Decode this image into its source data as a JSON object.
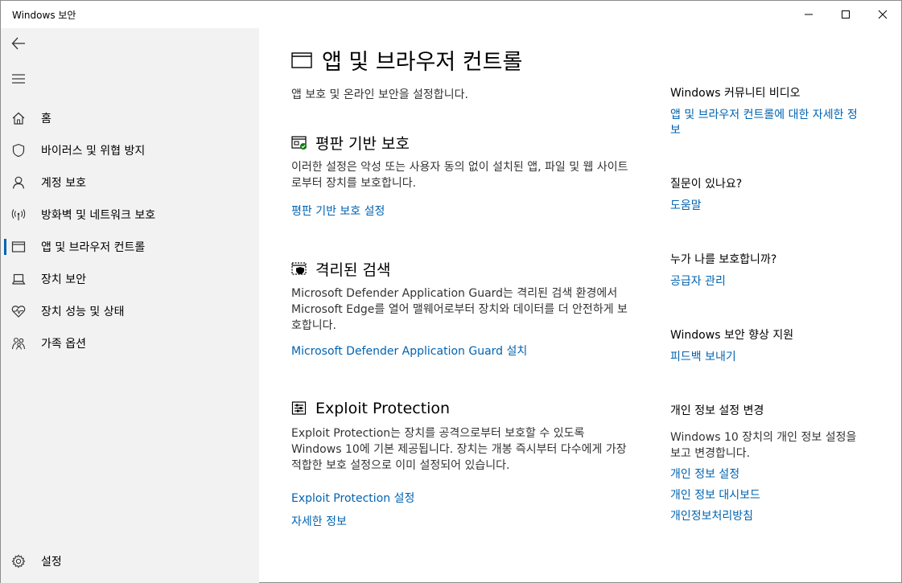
{
  "window": {
    "title": "Windows 보안",
    "controls": [
      "minimize-icon",
      "maximize-icon",
      "close-icon"
    ]
  },
  "sidebar": {
    "back_icon": "back-arrow-icon",
    "menu_icon": "hamburger-icon",
    "items": [
      {
        "label": "홈",
        "icon": "home-icon"
      },
      {
        "label": "바이러스 및 위협 방지",
        "icon": "shield-icon"
      },
      {
        "label": "계정 보호",
        "icon": "person-icon"
      },
      {
        "label": "방화벽 및 네트워크 보호",
        "icon": "antenna-icon"
      },
      {
        "label": "앱 및 브라우저 컨트롤",
        "icon": "app-window-icon",
        "active": true
      },
      {
        "label": "장치 보안",
        "icon": "laptop-icon"
      },
      {
        "label": "장치 성능 및 상태",
        "icon": "heart-pulse-icon"
      },
      {
        "label": "가족 옵션",
        "icon": "family-icon"
      }
    ],
    "settings": {
      "label": "설정",
      "icon": "gear-icon"
    }
  },
  "main": {
    "title": "앱 및 브라우저 컨트롤",
    "subtitle": "앱 보호 및 온라인 보안을 설정합니다.",
    "sections": [
      {
        "heading": "평판 기반 보호",
        "body": "이러한 설정은 악성 또는 사용자 동의 없이 설치된 앱, 파일 및 웹 사이트로부터 장치를 보호합니다.",
        "links": [
          "평판 기반 보호 설정"
        ]
      },
      {
        "heading": "격리된 검색",
        "body": "Microsoft Defender Application Guard는 격리된 검색 환경에서 Microsoft Edge를 열어 맬웨어로부터 장치와 데이터를 더 안전하게 보호합니다.",
        "links": [
          "Microsoft Defender Application Guard 설치"
        ]
      },
      {
        "heading": "Exploit Protection",
        "body": "Exploit Protection는 장치를 공격으로부터 보호할 수 있도록 Windows 10에 기본 제공됩니다. 장치는 개봉 즉시부터 다수에게 가장 적합한 보호 설정으로 이미 설정되어 있습니다.",
        "links": [
          "Exploit Protection 설정",
          "자세한 정보"
        ]
      }
    ]
  },
  "right": {
    "community": {
      "heading": "Windows 커뮤니티 비디오",
      "link": "앱 및 브라우저 컨트롤에 대한 자세한 정보"
    },
    "question": {
      "heading": "질문이 있나요?",
      "link": "도움말"
    },
    "who": {
      "heading": "누가 나를 보호합니까?",
      "link": "공급자 관리"
    },
    "improve": {
      "heading": "Windows 보안 향상 지원",
      "link": "피드백 보내기"
    },
    "privacy": {
      "heading": "개인 정보 설정 변경",
      "body": "Windows 10 장치의 개인 정보 설정을 보고 변경합니다.",
      "links": [
        "개인 정보 설정",
        "개인 정보 대시보드",
        "개인정보처리방침"
      ]
    }
  },
  "colors": {
    "accent": "#0063b1",
    "sidebar_bg": "#f2f2f2",
    "status_ok": "#107c10"
  }
}
